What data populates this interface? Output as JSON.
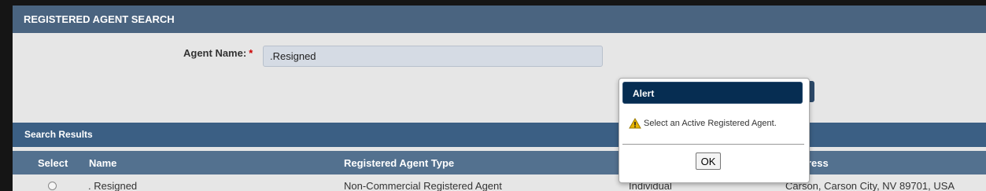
{
  "panel": {
    "title": "REGISTERED AGENT SEARCH"
  },
  "search": {
    "agent_label": "Agent Name:",
    "required_mark": "*",
    "agent_value": ".Resigned"
  },
  "results": {
    "title": "Search Results",
    "columns": [
      "Select",
      "Name",
      "Registered Agent Type",
      "",
      "ress"
    ],
    "rows": [
      {
        "name": ". Resigned",
        "type": "Non-Commercial Registered Agent",
        "category": "Individual",
        "address": "Carson, Carson City, NV 89701, USA"
      }
    ]
  },
  "alert": {
    "title": "Alert",
    "icon": "warning-icon",
    "message": "Select an Active Registered Agent.",
    "ok_label": "OK"
  },
  "colors": {
    "panel_header": "#4a6480",
    "results_header": "#3b5f84",
    "column_header": "#53718f",
    "alert_title": "#062d52",
    "warning": "#e8b400"
  }
}
